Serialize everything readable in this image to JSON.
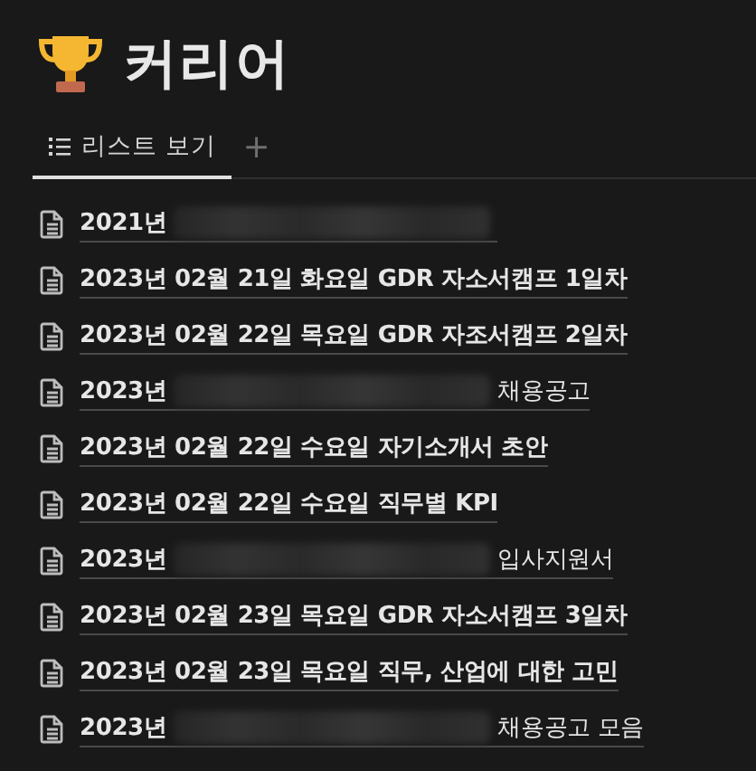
{
  "page": {
    "title": "커리어"
  },
  "tabs": [
    {
      "label": "리스트 보기",
      "selected": true
    }
  ],
  "add_view": "+",
  "items": [
    {
      "title": "2021년",
      "redacted": true
    },
    {
      "title": "2023년 02월 21일 화요일 GDR 자소서캠프 1일차",
      "redacted": false
    },
    {
      "title": "2023년 02월 22일 목요일 GDR 자조서캠프 2일차",
      "redacted": false
    },
    {
      "title": "2023년",
      "redacted": true,
      "suffix": "채용공고"
    },
    {
      "title": "2023년 02월 22일 수요일 자기소개서 초안",
      "redacted": false
    },
    {
      "title": "2023년 02월 22일 수요일 직무별 KPI",
      "redacted": false
    },
    {
      "title": "2023년",
      "redacted": true,
      "suffix": "입사지원서"
    },
    {
      "title": "2023년 02월 23일 목요일 GDR 자소서캠프 3일차",
      "redacted": false
    },
    {
      "title": "2023년 02월 23일 목요일 직무, 산업에 대한 고민",
      "redacted": false
    },
    {
      "title": "2023년",
      "redacted": true,
      "suffix": "채용공고 모음"
    }
  ]
}
